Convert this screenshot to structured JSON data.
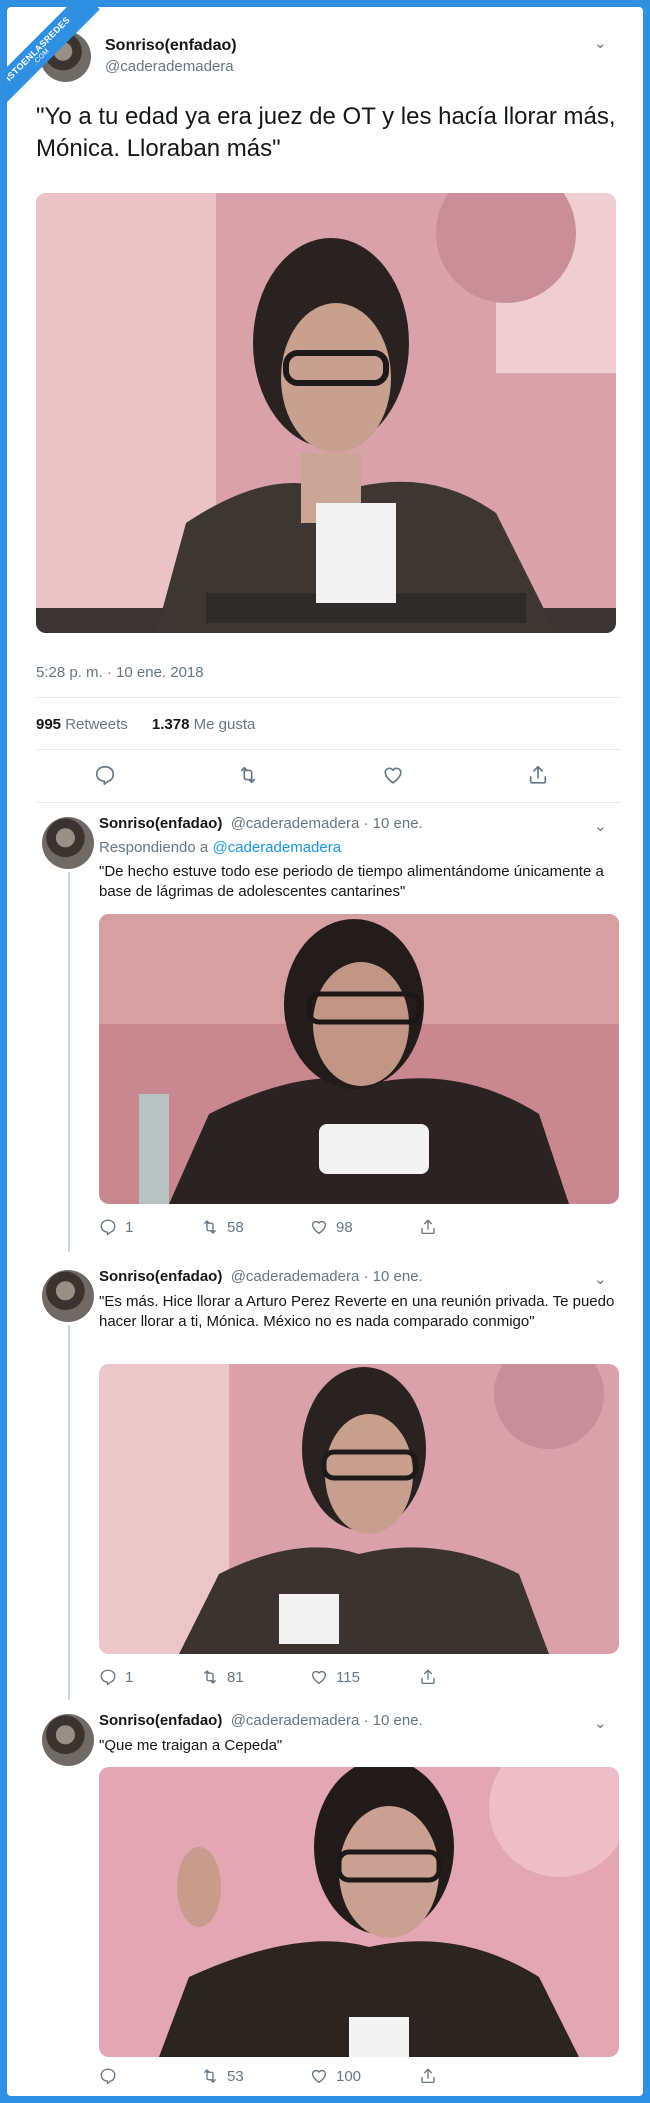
{
  "watermark": {
    "line1": "VISTOENLASREDES",
    "line2": ".COM"
  },
  "main_tweet": {
    "display_name": "Sonriso(enfadao)",
    "handle": "@caderademadera",
    "text": "\"Yo a tu edad ya era juez de OT y les hacía llorar más, Mónica. Lloraban más\"",
    "timestamp": "5:28 p. m. · 10 ene. 2018",
    "retweets_count": "995",
    "retweets_label": "Retweets",
    "likes_count": "1.378",
    "likes_label": "Me gusta"
  },
  "replies": [
    {
      "display_name": "Sonriso(enfadao)",
      "handle_date": "@caderademadera · 10 ene.",
      "replying_prefix": "Respondiendo a",
      "replying_handle": "@caderademadera",
      "text": "\"De hecho estuve todo ese periodo de tiempo alimentándome únicamente a base de lágrimas de adolescentes cantarines\"",
      "reply_count": "1",
      "retweet_count": "58",
      "like_count": "98"
    },
    {
      "display_name": "Sonriso(enfadao)",
      "handle_date": "@caderademadera · 10 ene.",
      "text": "\"Es más. Hice llorar a Arturo Perez Reverte en una reunión privada. Te puedo hacer llorar a ti, Mónica. México no es nada comparado conmigo\"",
      "reply_count": "1",
      "retweet_count": "81",
      "like_count": "115"
    },
    {
      "display_name": "Sonriso(enfadao)",
      "handle_date": "@caderademadera · 10 ene.",
      "text": "\"Que me traigan a Cepeda\"",
      "reply_count": "",
      "retweet_count": "53",
      "like_count": "100"
    }
  ],
  "icons": {
    "reply": "reply-icon",
    "retweet": "retweet-icon",
    "like": "heart-icon",
    "share": "share-icon",
    "more": "chevron-down-icon"
  },
  "colors": {
    "accent": "#1b95e0",
    "background_blue": "#2f8fe0",
    "muted": "#657786"
  }
}
